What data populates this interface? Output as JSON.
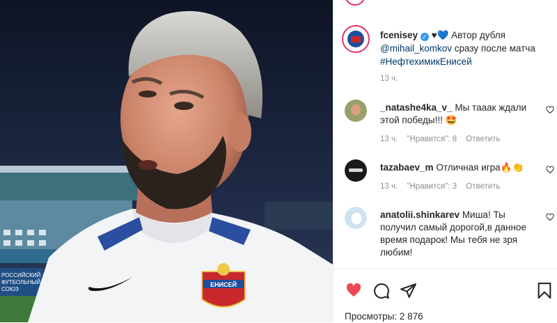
{
  "post": {
    "author": "fcenisey",
    "caption_tail": "Автор дубля",
    "mention": "@mihail_komkov",
    "caption_mid": "сразу после матча",
    "hashtag": "#НефтехимикЕнисей",
    "time": "13 ч.",
    "verified_icon": "verified-badge-icon",
    "hearts": "♥💙"
  },
  "media": {
    "banner_lines": [
      "РОССИЙСКИЙ",
      "ФУТБОЛЬНЫЙ",
      "СОЮЗ"
    ],
    "crest_text": "ЕНИСЕЙ"
  },
  "comments": [
    {
      "user": "_natashe4ka_v_",
      "text": "Мы тааак ждали этой победы!!! 🤩",
      "time": "13 ч.",
      "likes": "\"Нравится\": 8",
      "reply": "Ответить"
    },
    {
      "user": "tazabaev_m",
      "text": "Отличная игра🔥👏",
      "time": "13 ч.",
      "likes": "\"Нравится\": 3",
      "reply": "Ответить"
    },
    {
      "user": "anatolii.shinkarev",
      "text": "Миша! Ты получил самый дорогой,в данное время подарок! Мы тебя не зря любим!",
      "time": "",
      "likes": "",
      "reply": ""
    }
  ],
  "footer": {
    "views": "Просмотры: 2 876"
  },
  "colors": {
    "like_red": "#ed4956",
    "link_blue": "#00376b",
    "verified_blue": "#3897f0"
  }
}
